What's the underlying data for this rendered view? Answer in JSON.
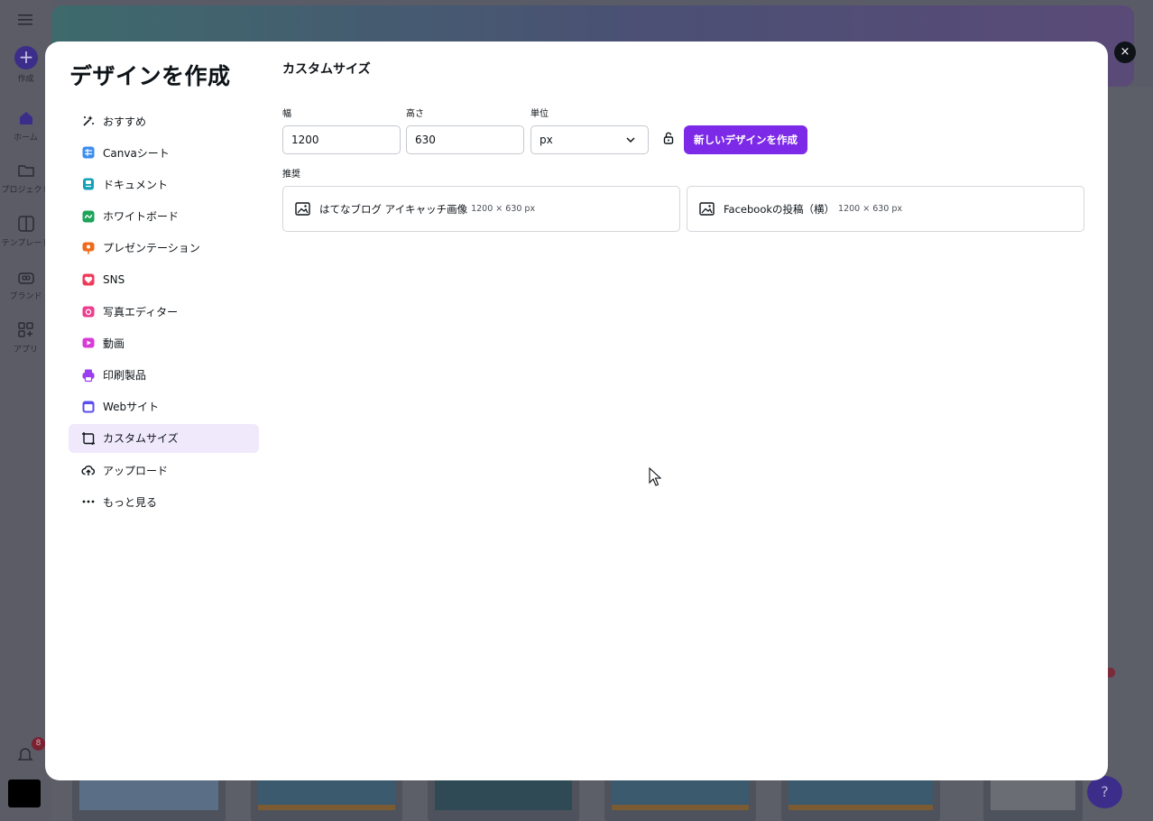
{
  "background": {
    "rail_items": [
      {
        "label": "作成",
        "icon": "plus-icon"
      },
      {
        "label": "ホーム",
        "icon": "home-icon"
      },
      {
        "label": "プロジェクト",
        "icon": "folder-icon"
      },
      {
        "label": "テンプレート",
        "icon": "template-icon"
      },
      {
        "label": "ブランド",
        "icon": "brand-icon"
      },
      {
        "label": "アプリ",
        "icon": "apps-icon"
      }
    ],
    "notification_count": "8",
    "help_label": "?"
  },
  "modal": {
    "title": "デザインを作成",
    "close_label": "×",
    "sidebar": {
      "items": [
        {
          "label": "おすすめ",
          "icon": "sparkle-icon",
          "active": false
        },
        {
          "label": "Canvaシート",
          "icon": "sheet-icon",
          "active": false
        },
        {
          "label": "ドキュメント",
          "icon": "document-icon",
          "active": false
        },
        {
          "label": "ホワイトボード",
          "icon": "whiteboard-icon",
          "active": false
        },
        {
          "label": "プレゼンテーション",
          "icon": "presentation-icon",
          "active": false
        },
        {
          "label": "SNS",
          "icon": "heart-icon",
          "active": false
        },
        {
          "label": "写真エディター",
          "icon": "camera-icon",
          "active": false
        },
        {
          "label": "動画",
          "icon": "video-icon",
          "active": false
        },
        {
          "label": "印刷製品",
          "icon": "print-icon",
          "active": false
        },
        {
          "label": "Webサイト",
          "icon": "website-icon",
          "active": false
        },
        {
          "label": "カスタムサイズ",
          "icon": "custom-size-icon",
          "active": true
        },
        {
          "label": "アップロード",
          "icon": "upload-icon",
          "active": false
        },
        {
          "label": "もっと見る",
          "icon": "more-icon",
          "active": false
        }
      ]
    },
    "panel": {
      "title": "カスタムサイズ",
      "width_label": "幅",
      "width_value": "1200",
      "height_label": "高さ",
      "height_value": "630",
      "unit_label": "単位",
      "unit_value": "px",
      "create_button_label": "新しいデザインを作成",
      "recommended_label": "推奨",
      "recommended": [
        {
          "name": "はてなブログ アイキャッチ画像",
          "size": "1200 × 630 px"
        },
        {
          "name": "Facebookの投稿（横）",
          "size": "1200 × 630 px"
        }
      ]
    }
  },
  "colors": {
    "accent": "#7d2ae8",
    "active_bg": "#efe9fb",
    "text": "#0e1318"
  }
}
